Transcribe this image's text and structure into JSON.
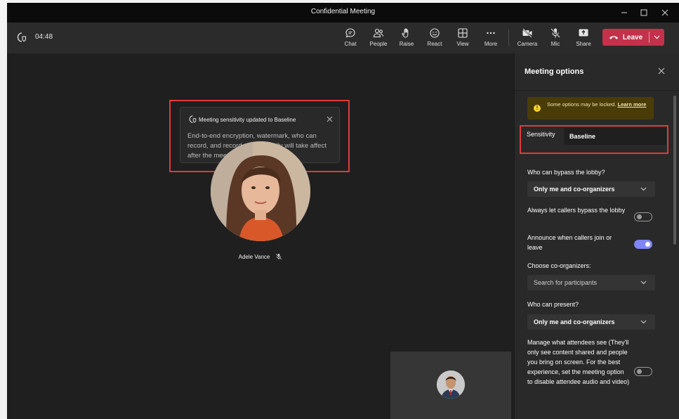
{
  "window": {
    "title": "Confidential Meeting"
  },
  "toolbar": {
    "timer": "04:48",
    "buttons": {
      "chat": "Chat",
      "people": "People",
      "raise": "Raise",
      "react": "React",
      "view": "View",
      "more": "More",
      "camera": "Camera",
      "mic": "Mic",
      "share": "Share"
    },
    "leave_label": "Leave"
  },
  "notification": {
    "title": "Meeting sensitivity updated to Baseline",
    "body": "End-to-end encryption, watermark, who can record, and record automatically will take affect after the meeting has restarted"
  },
  "participant": {
    "name": "Adele Vance"
  },
  "panel": {
    "title": "Meeting options",
    "warning_text": "Some options may be locked.",
    "warning_link": "Learn more",
    "sensitivity_label": "Sensitivity",
    "sensitivity_value": "Baseline",
    "lobby_question": "Who can bypass the lobby?",
    "lobby_value": "Only me and co-organizers",
    "callers_bypass_label": "Always let callers bypass the lobby",
    "callers_bypass_on": false,
    "announce_label": "Announce when callers join or leave",
    "announce_on": true,
    "coorganizers_label": "Choose co-organizers:",
    "coorganizers_placeholder": "Search for participants",
    "present_question": "Who can present?",
    "present_value": "Only me and co-organizers",
    "attendees_label": "Manage what attendees see (They'll only see content shared and people you bring on screen. For the best experience, set the meeting option to disable attendee audio and video)",
    "attendees_on": false
  },
  "colors": {
    "leave": "#c4314b",
    "toggle_on": "#7f85f5",
    "highlight": "#e03a3a",
    "warning_bg": "#4a3c08"
  }
}
